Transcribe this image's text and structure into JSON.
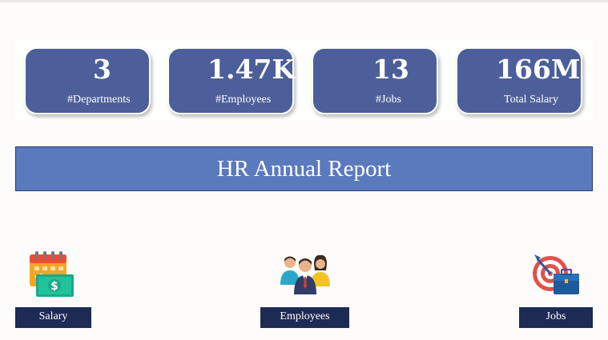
{
  "kpis": [
    {
      "value": "3",
      "label": "#Departments"
    },
    {
      "value": "1.47K",
      "label": "#Employees"
    },
    {
      "value": "13",
      "label": "#Jobs"
    },
    {
      "value": "166M",
      "label": "Total Salary"
    }
  ],
  "banner": {
    "title": "HR Annual Report"
  },
  "nav": {
    "salary": {
      "label": "Salary",
      "icon": "calendar-money-icon"
    },
    "employees": {
      "label": "Employees",
      "icon": "people-group-icon"
    },
    "jobs": {
      "label": "Jobs",
      "icon": "target-briefcase-icon"
    }
  },
  "colors": {
    "card": "#4d5f9a",
    "banner": "#5b79bd",
    "nav_button": "#1e2b54",
    "background": "#fdfcfa"
  }
}
